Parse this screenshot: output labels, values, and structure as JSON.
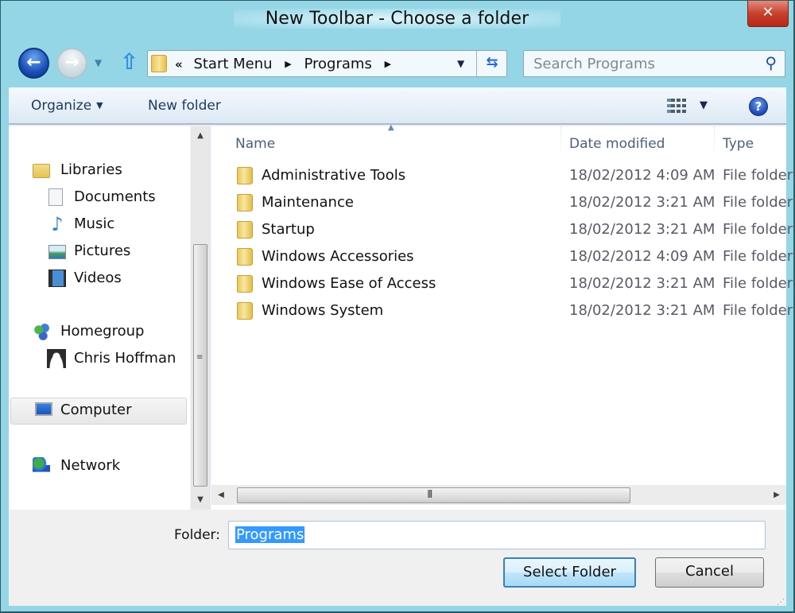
{
  "window": {
    "title": "New Toolbar - Choose a folder",
    "close_label": "✕"
  },
  "nav": {
    "back_glyph": "←",
    "forward_glyph": "→",
    "history_dropdown_glyph": "▼",
    "up_glyph": "⇧",
    "address": {
      "overflow_glyph": "«",
      "crumbs": [
        "Start Menu",
        "Programs"
      ],
      "separator_glyph": "▶",
      "dropdown_glyph": "▼",
      "refresh_glyph": "⇆"
    },
    "search": {
      "placeholder": "Search Programs",
      "icon_glyph": "⚲"
    }
  },
  "command_bar": {
    "organize_label": "Organize",
    "organize_dd_glyph": "▼",
    "new_folder_label": "New folder",
    "views_dd_glyph": "▼",
    "help_glyph": "?"
  },
  "nav_pane": {
    "items": [
      {
        "label": "Libraries",
        "icon": "libraries-icon",
        "glyph": ""
      },
      {
        "label": "Documents",
        "icon": "documents-icon",
        "glyph": "📄"
      },
      {
        "label": "Music",
        "icon": "music-icon",
        "glyph": "♪"
      },
      {
        "label": "Pictures",
        "icon": "pictures-icon",
        "glyph": ""
      },
      {
        "label": "Videos",
        "icon": "videos-icon",
        "glyph": ""
      },
      {
        "label": "Homegroup",
        "icon": "homegroup-icon",
        "glyph": ""
      },
      {
        "label": "Chris Hoffman",
        "icon": "user-icon",
        "glyph": ""
      },
      {
        "label": "Computer",
        "icon": "computer-icon",
        "glyph": ""
      },
      {
        "label": "Network",
        "icon": "network-icon",
        "glyph": ""
      }
    ],
    "selected": "Computer",
    "scroll_up_glyph": "▲",
    "scroll_down_glyph": "▼",
    "grip_glyph": "≡"
  },
  "file_list": {
    "columns": [
      "Name",
      "Date modified",
      "Type"
    ],
    "sort_glyph": "▲",
    "rows": [
      {
        "name": "Administrative Tools",
        "date": "18/02/2012 4:09 AM",
        "type": "File folder"
      },
      {
        "name": "Maintenance",
        "date": "18/02/2012 3:21 AM",
        "type": "File folder"
      },
      {
        "name": "Startup",
        "date": "18/02/2012 3:21 AM",
        "type": "File folder"
      },
      {
        "name": "Windows Accessories",
        "date": "18/02/2012 4:09 AM",
        "type": "File folder"
      },
      {
        "name": "Windows Ease of Access",
        "date": "18/02/2012 3:21 AM",
        "type": "File folder"
      },
      {
        "name": "Windows System",
        "date": "18/02/2012 3:21 AM",
        "type": "File folder"
      }
    ],
    "scroll_left_glyph": "◀",
    "scroll_right_glyph": "▶",
    "grip_glyph": "III"
  },
  "footer": {
    "folder_label": "Folder:",
    "folder_value": "Programs",
    "select_label": "Select Folder",
    "cancel_label": "Cancel"
  }
}
